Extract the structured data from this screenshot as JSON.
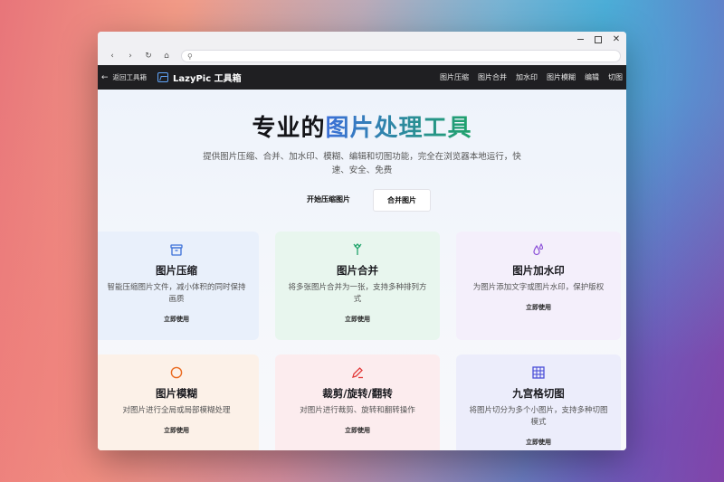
{
  "browser": {
    "url": ""
  },
  "appnav": {
    "back_label": "返回工具箱",
    "brand": "LazyPic 工具箱",
    "links": [
      "图片压缩",
      "图片合并",
      "加水印",
      "图片模糊",
      "编辑",
      "切图"
    ]
  },
  "hero": {
    "title_prefix": "专业的",
    "title_highlight": "图片处理工具",
    "subtitle": "提供图片压缩、合并、加水印、模糊、编辑和切图功能，完全在浏览器本地运行，快速、安全、免费",
    "btn_primary": "开始压缩图片",
    "btn_secondary": "合并图片"
  },
  "cards": [
    {
      "title": "图片压缩",
      "desc": "智能压缩图片文件，减小体积的同时保持画质",
      "use": "立即使用",
      "icon": "archive-icon",
      "color": "#3b6fd8"
    },
    {
      "title": "图片合并",
      "desc": "将多张图片合并为一张，支持多种排列方式",
      "use": "立即使用",
      "icon": "merge-icon",
      "color": "#1fa36a"
    },
    {
      "title": "图片加水印",
      "desc": "为图片添加文字或图片水印，保护版权",
      "use": "立即使用",
      "icon": "droplets-icon",
      "color": "#8b4fd8"
    },
    {
      "title": "图片模糊",
      "desc": "对图片进行全局或局部模糊处理",
      "use": "立即使用",
      "icon": "circle-icon",
      "color": "#ea6a1f"
    },
    {
      "title": "裁剪/旋转/翻转",
      "desc": "对图片进行裁剪、旋转和翻转操作",
      "use": "立即使用",
      "icon": "pen-icon",
      "color": "#e23b3b"
    },
    {
      "title": "九宫格切图",
      "desc": "将图片切分为多个小图片，支持多种切图模式",
      "use": "立即使用",
      "icon": "grid-icon",
      "color": "#4b4fd8"
    }
  ]
}
